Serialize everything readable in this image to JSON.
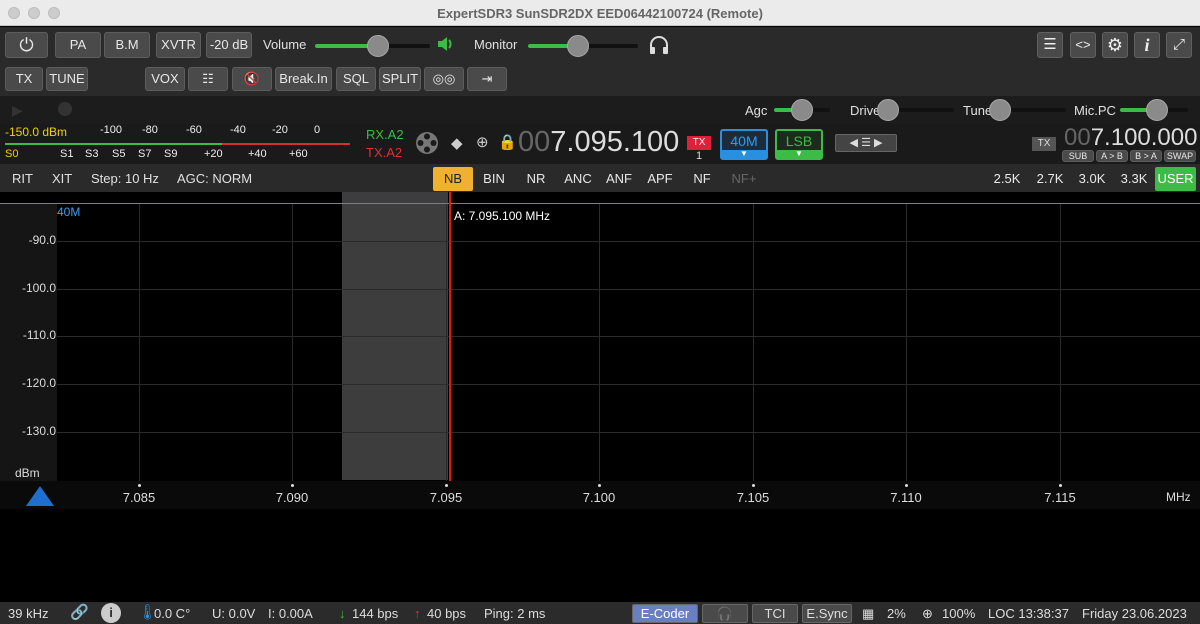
{
  "window": {
    "title": "ExpertSDR3 SunSDR2DX EED06442100724 (Remote)"
  },
  "toolbar1": {
    "pa": "PA",
    "bm": "B.M",
    "xvtr": "XVTR",
    "att": "-20 dB",
    "volume_label": "Volume",
    "volume_level": 0.55,
    "monitor_label": "Monitor",
    "monitor_level": 0.45
  },
  "toolbar2": {
    "tx": "TX",
    "tune": "TUNE",
    "vox": "VOX",
    "breakin": "Break.In",
    "sql": "SQL",
    "split": "SPLIT"
  },
  "levels": {
    "agc": "Agc",
    "drive": "Drive",
    "tune": "Tune",
    "micpc": "Mic.PC",
    "agc_level": 0.5,
    "drive_level": 0.0,
    "tune_level": 0.0,
    "micpc_level": 0.55
  },
  "smeter": {
    "readout": "-150.0 dBm",
    "scale_top": [
      "-100",
      "-80",
      "-60",
      "-40",
      "-20",
      "0"
    ],
    "scale_bottom": [
      "S0",
      "S1",
      "S3",
      "S5",
      "S7",
      "S9",
      "+20",
      "+40",
      "+60"
    ],
    "rx_ant": "RX.A2",
    "tx_ant": "TX.A2"
  },
  "vfo_a": {
    "freq_dim": "00",
    "freq": "7.095.100",
    "tx_badge": "TX",
    "rx_num": "1",
    "band": "40M",
    "mode": "LSB"
  },
  "vfo_b": {
    "tx_badge": "TX",
    "freq_dim": "00",
    "freq": "7.100.000",
    "sub": "SUB",
    "atob": "A > B",
    "btoa": "B > A",
    "swap": "SWAP"
  },
  "dsp": {
    "rit": "RIT",
    "xit": "XIT",
    "step": "Step: 10 Hz",
    "agc": "AGC: NORM",
    "filters": [
      "NB",
      "BIN",
      "NR",
      "ANC",
      "ANF",
      "APF",
      "NF",
      "NF+"
    ],
    "active_filter": "NB",
    "bandwidths": [
      "2.5K",
      "2.7K",
      "3.0K",
      "3.3K",
      "USER"
    ],
    "active_bandwidth": "USER"
  },
  "spectrum": {
    "band_label": "40M",
    "marker": "A: 7.095.100 MHz",
    "y_ticks": [
      "-90.0",
      "-100.0",
      "-110.0",
      "-120.0",
      "-130.0"
    ],
    "y_unit": "dBm",
    "x_ticks": [
      "7.085",
      "7.090",
      "7.095",
      "7.100",
      "7.105",
      "7.110",
      "7.115"
    ],
    "x_unit": "MHz"
  },
  "status": {
    "bandwidth": "39 kHz",
    "temp": "0.0 C°",
    "voltage": "U: 0.0V",
    "current": "I: 0.00A",
    "down": "144 bps",
    "up": "40 bps",
    "ping": "Ping: 2 ms",
    "ecoder": "E-Coder",
    "tci": "TCI",
    "esync": "E.Sync",
    "cpu": "2%",
    "zoom": "100%",
    "loc": "LOC 13:38:37",
    "date": "Friday 23.06.2023"
  }
}
